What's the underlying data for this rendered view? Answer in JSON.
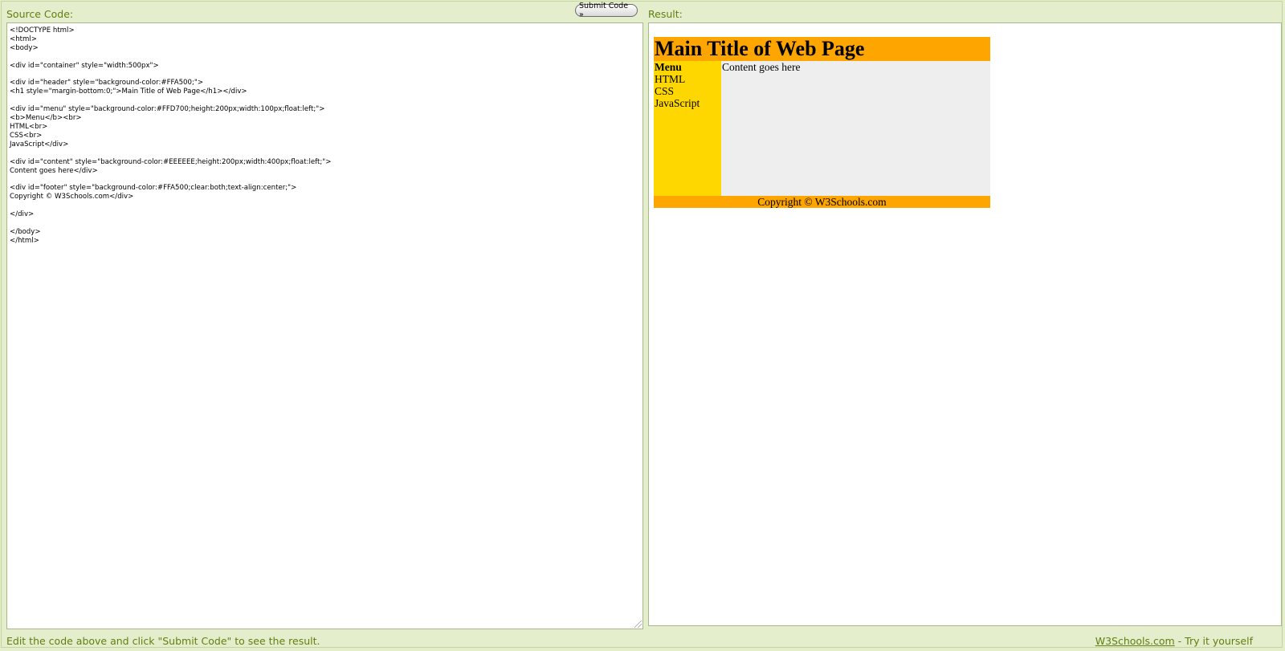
{
  "labels": {
    "source": "Source Code:",
    "result": "Result:"
  },
  "submit": {
    "label": "Submit Code »"
  },
  "source_code": {
    "lines": [
      "<!DOCTYPE html>",
      "<html>",
      "<body>",
      "",
      "<div id=\"container\" style=\"width:500px\">",
      "",
      "<div id=\"header\" style=\"background-color:#FFA500;\">",
      "<h1 style=\"margin-bottom:0;\">Main Title of Web Page</h1></div>",
      "",
      "<div id=\"menu\" style=\"background-color:#FFD700;height:200px;width:100px;float:left;\">",
      "<b>Menu</b><br>",
      "HTML<br>",
      "CSS<br>",
      "JavaScript</div>",
      "",
      "<div id=\"content\" style=\"background-color:#EEEEEE;height:200px;width:400px;float:left;\">",
      "Content goes here</div>",
      "",
      "<div id=\"footer\" style=\"background-color:#FFA500;clear:both;text-align:center;\">",
      "Copyright © W3Schools.com</div>",
      "",
      "</div>",
      "",
      "</body>",
      "</html>"
    ]
  },
  "result": {
    "title": "Main Title of Web Page",
    "menu_heading": "Menu",
    "menu_items": [
      "HTML",
      "CSS",
      "JavaScript"
    ],
    "content": "Content goes here",
    "footer": "Copyright © W3Schools.com"
  },
  "footer": {
    "hint": "Edit the code above and click \"Submit Code\" to see the result.",
    "link": "W3Schools.com",
    "suffix": " - Try it yourself"
  },
  "colors": {
    "page_bg": "#e5eecc",
    "label_text": "#617f10",
    "header_bg": "#FFA500",
    "menu_bg": "#FFD700",
    "content_bg": "#EEEEEE"
  }
}
